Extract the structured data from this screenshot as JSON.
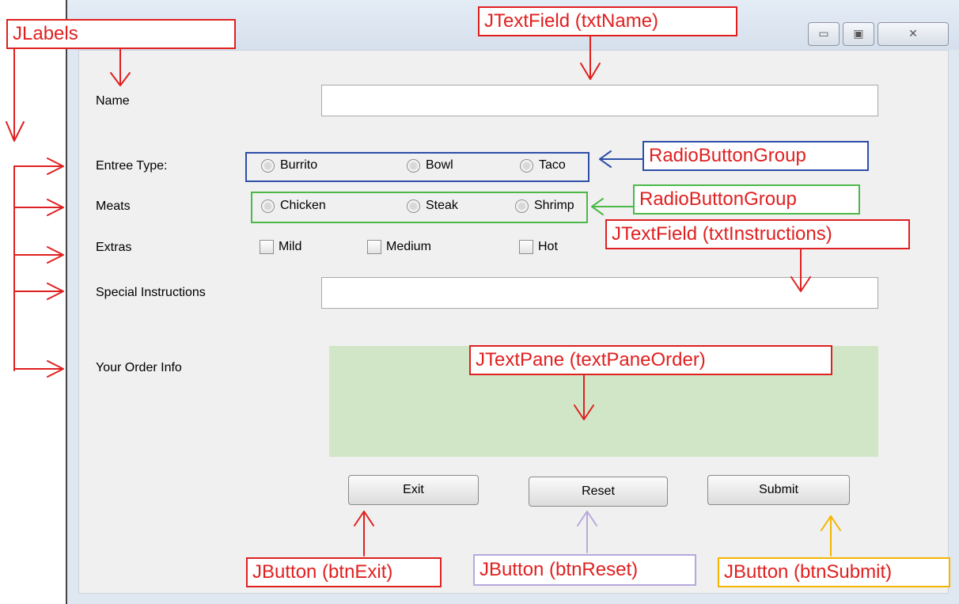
{
  "window": {
    "buttons": [
      "minimize-icon",
      "maximize-icon",
      "close-icon"
    ],
    "button_glyphs": {
      "minimize": "▭",
      "maximize": "▣",
      "close": "✕"
    }
  },
  "form": {
    "name_label": "Name",
    "entree_label": "Entree Type:",
    "meats_label": "Meats",
    "extras_label": "Extras",
    "instructions_label": "Special Instructions",
    "order_label": "Your Order Info",
    "name_value": "",
    "instructions_value": "",
    "entree_options": [
      "Burrito",
      "Bowl",
      "Taco"
    ],
    "meat_options": [
      "Chicken",
      "Steak",
      "Shrimp"
    ],
    "extras_options": [
      "Mild",
      "Medium",
      "Hot"
    ],
    "buttons": {
      "exit": "Exit",
      "reset": "Reset",
      "submit": "Submit"
    }
  },
  "annotations": {
    "labels": "JLabels",
    "txt_name": "JTextField (txtName)",
    "radio_group_entree": "RadioButtonGroup",
    "radio_group_meats": "RadioButtonGroup",
    "txt_instructions": "JTextField (txtInstructions)",
    "text_pane": "JTextPane (textPaneOrder)",
    "btn_exit": "JButton (btnExit)",
    "btn_reset": "JButton (btnReset)",
    "btn_submit": "JButton (btnSubmit)"
  },
  "colors": {
    "red": "#e02020",
    "blue": "#2e4ea8",
    "green": "#4cb848",
    "purple": "#b7a9dc",
    "yellow": "#f4b400",
    "text_pane": "#d0e6c6"
  }
}
